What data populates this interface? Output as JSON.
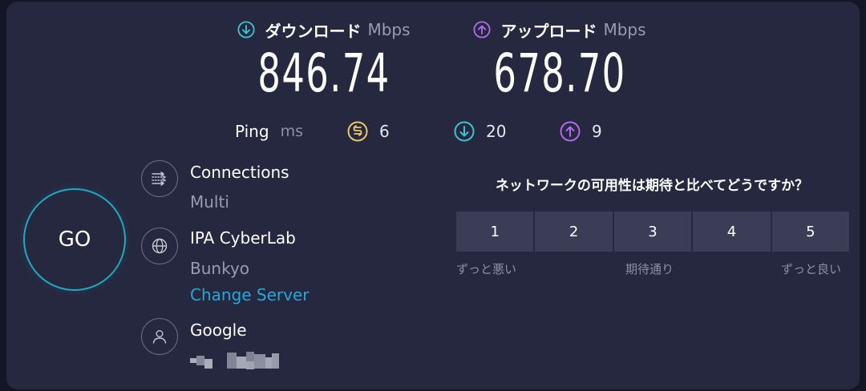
{
  "download": {
    "label": "ダウンロード",
    "unit": "Mbps",
    "value": "846.74",
    "icon": "download-arrow-icon",
    "color": "#3fc1d0"
  },
  "upload": {
    "label": "アップロード",
    "unit": "Mbps",
    "value": "678.70",
    "icon": "upload-arrow-icon",
    "color": "#b26be6"
  },
  "ping": {
    "title": "Ping",
    "unit": "ms",
    "idle": "6",
    "down": "20",
    "up": "9",
    "idle_color": "#e8c76a",
    "down_color": "#3fc1d0",
    "up_color": "#b26be6"
  },
  "go_label": "GO",
  "connections": {
    "title": "Connections",
    "value": "Multi",
    "icon": "connections-icon"
  },
  "server": {
    "name": "IPA CyberLab",
    "location": "Bunkyo",
    "change_label": "Change Server",
    "icon": "globe-icon"
  },
  "provider": {
    "name": "Google",
    "icon": "user-icon"
  },
  "survey": {
    "question": "ネットワークの可用性は期待と比べてどうですか？",
    "options": [
      "1",
      "2",
      "3",
      "4",
      "5"
    ],
    "low_label": "ずっと悪い",
    "mid_label": "期待通り",
    "high_label": "ずっと良い"
  },
  "colors": {
    "background": "#262840",
    "accent": "#20aabe",
    "link": "#22a9d9"
  }
}
